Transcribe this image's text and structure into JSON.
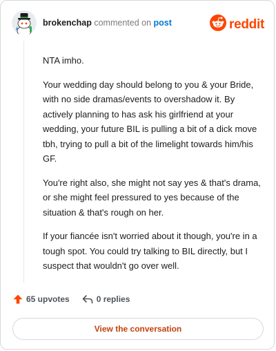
{
  "header": {
    "username": "brokenchap",
    "verb": "commented on",
    "target": "post",
    "brand": "reddit"
  },
  "comment": {
    "paragraphs": [
      "NTA imho.",
      "Your wedding day should belong to you & your Bride, with no side dramas/events to overshadow it. By actively planning to has ask his girlfriend at your wedding, your future BIL is pulling a bit of a dick move tbh, trying to pull a bit of the limelight towards him/his GF.",
      "You're right also, she might not say yes & that's drama, or she might feel pressured to yes because of the situation & that's rough on her.",
      "If your fiancée isn't worried about it though, you're in a tough spot. You could try talking to BIL directly, but I suspect that wouldn't go over well."
    ]
  },
  "actions": {
    "upvotes": "65 upvotes",
    "replies": "0 replies"
  },
  "footer": {
    "view_label": "View the conversation"
  },
  "colors": {
    "brand": "#ff4500",
    "link": "#0079d3",
    "button_text": "#c2410c"
  },
  "icons": {
    "avatar": "snoo-avatar-icon",
    "logo": "reddit-logo-icon",
    "upvote": "upvote-arrow-icon",
    "reply": "reply-arrow-icon"
  }
}
